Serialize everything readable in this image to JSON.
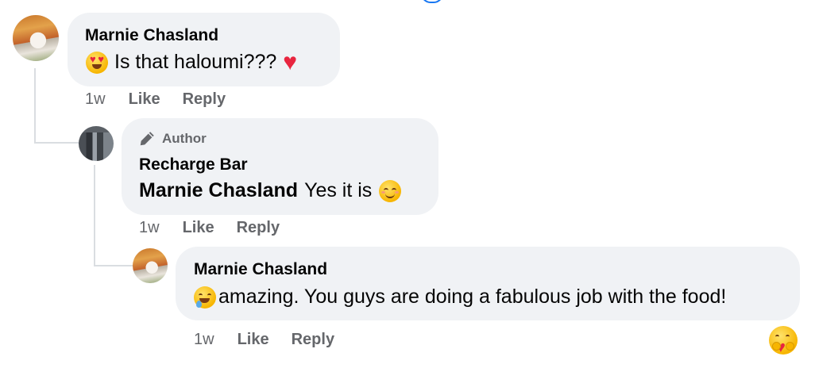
{
  "comments": [
    {
      "author": "Marnie Chasland",
      "text": "Is that haloumi???",
      "emoji_prefix": "heart-eyes-emoji",
      "emoji_suffix": "red-heart-emoji",
      "time": "1w",
      "like_label": "Like",
      "reply_label": "Reply"
    },
    {
      "badge": "Author",
      "author": "Recharge Bar",
      "mention": "Marnie Chasland",
      "text": "Yes it is",
      "emoji_suffix": "smiling-face-emoji",
      "time": "1w",
      "like_label": "Like",
      "reply_label": "Reply"
    },
    {
      "author": "Marnie Chasland",
      "emoji_prefix": "drooling-face-emoji",
      "text": "amazing. You guys are doing a fabulous job with the food!",
      "time": "1w",
      "like_label": "Like",
      "reply_label": "Reply",
      "reaction": "care-reaction-icon"
    }
  ],
  "colors": {
    "bubble": "#f0f2f5",
    "secondary_text": "#65676b",
    "primary_text": "#050505",
    "thread_line": "#dadde1",
    "accent": "#1877f2"
  }
}
